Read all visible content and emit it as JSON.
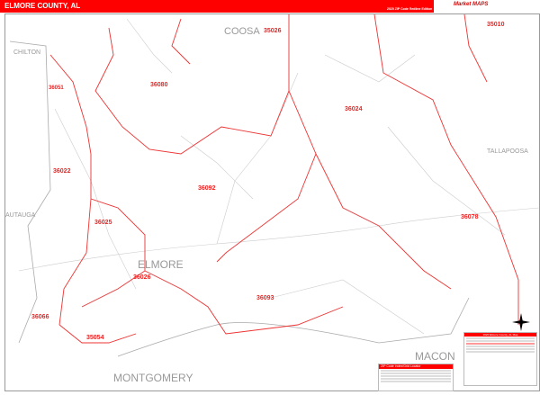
{
  "header": {
    "title": "ELMORE COUNTY, AL",
    "edition": "2020 ZIP Code Redline Edition",
    "logo": "Market MAPS"
  },
  "colors": {
    "accent": "#ff0000",
    "boundary": "#ee3333",
    "road": "#cccccc"
  },
  "counties": [
    {
      "name": "COOSA"
    },
    {
      "name": "CHILTON"
    },
    {
      "name": "TALLAPOOSA"
    },
    {
      "name": "AUTAUGA"
    },
    {
      "name": "ELMORE"
    },
    {
      "name": "MONTGOMERY"
    },
    {
      "name": "MACON"
    }
  ],
  "zips": [
    "35026",
    "35010",
    "36051",
    "36080",
    "36024",
    "36022",
    "36092",
    "36025",
    "36078",
    "36026",
    "36093",
    "36066",
    "35054"
  ],
  "legend": {
    "title": "2020 Elmore County, AL Map"
  },
  "index": {
    "title": "ZIP Code Index/Grid Locator"
  },
  "compass": "compass-rose"
}
